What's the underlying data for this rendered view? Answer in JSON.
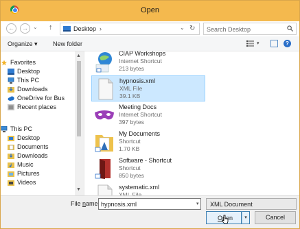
{
  "window": {
    "title": "Open"
  },
  "nav": {
    "back_glyph": "←",
    "forward_glyph": "→",
    "history_glyph": "⌄",
    "up_glyph": "↑",
    "address_crumb": "Desktop",
    "crumb_separator": "›",
    "address_dropdown_glyph": "⌄",
    "refresh_glyph": "↻",
    "search_placeholder": "Search Desktop"
  },
  "toolbar": {
    "organize_label": "Organize ▾",
    "new_folder_label": "New folder",
    "view_dropdown_glyph": "▾",
    "help_glyph": "?"
  },
  "sidebar": {
    "scroll_up_glyph": "▲",
    "scroll_down_glyph": "▼",
    "favorites": [
      {
        "label": "Favorites",
        "icon": "star-icon"
      },
      {
        "label": "Desktop",
        "icon": "desktop-icon"
      },
      {
        "label": "This PC",
        "icon": "computer-icon"
      },
      {
        "label": "Downloads",
        "icon": "downloads-icon"
      },
      {
        "label": "OneDrive for Bus",
        "icon": "onedrive-icon"
      },
      {
        "label": "Recent places",
        "icon": "recent-places-icon"
      }
    ],
    "thispc": [
      {
        "label": "This PC",
        "icon": "computer-icon"
      },
      {
        "label": "Desktop",
        "icon": "desktop-icon"
      },
      {
        "label": "Documents",
        "icon": "documents-icon"
      },
      {
        "label": "Downloads",
        "icon": "downloads-icon"
      },
      {
        "label": "Music",
        "icon": "music-icon"
      },
      {
        "label": "Pictures",
        "icon": "pictures-icon"
      },
      {
        "label": "Videos",
        "icon": "videos-icon"
      }
    ]
  },
  "files": [
    {
      "name": "CIAP Workshops",
      "type": "Internet Shortcut",
      "size": "213 bytes",
      "icon": "shortcut-globe-icon"
    },
    {
      "name": "hypnosis.xml",
      "type": "XML File",
      "size": "39.1 KB",
      "icon": "xml-file-icon",
      "selected": true
    },
    {
      "name": "Meeting Docs",
      "type": "Internet Shortcut",
      "size": "397 bytes",
      "icon": "purple-mask-icon"
    },
    {
      "name": "My Documents",
      "type": "Shortcut",
      "size": "1.70 KB",
      "icon": "folder-shortcut-icon"
    },
    {
      "name": "Software - Shortcut",
      "type": "Shortcut",
      "size": "850 bytes",
      "icon": "door-shortcut-icon"
    },
    {
      "name": "systematic.xml",
      "type": "XML File",
      "size": "",
      "icon": "xml-file-icon"
    }
  ],
  "filelist": {
    "scroll_up_glyph": "▲",
    "scroll_down_glyph": "▼"
  },
  "footer": {
    "filename_label_prefix": "File ",
    "filename_label_accel": "n",
    "filename_label_suffix": "ame:",
    "filename_value": "hypnosis.xml",
    "filename_dropdown_glyph": "▾",
    "filetype_value": "XML Document",
    "filetype_dropdown_glyph": "⌄",
    "open_accel": "O",
    "open_rest": "pen",
    "open_split_glyph": "▾",
    "cancel_label": "Cancel"
  },
  "colors": {
    "titlebar": "#f4b94e",
    "selection": "#cce8ff",
    "accent": "#2a6fc9"
  }
}
